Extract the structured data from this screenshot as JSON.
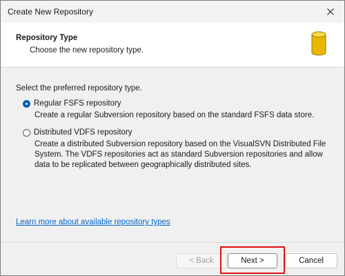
{
  "window": {
    "title": "Create New Repository"
  },
  "header": {
    "title": "Repository Type",
    "subtitle": "Choose the new repository type.",
    "icon": "database-icon"
  },
  "content": {
    "prompt": "Select the preferred repository type.",
    "options": [
      {
        "label": "Regular FSFS repository",
        "selected": true,
        "description": "Create a regular Subversion repository based on the standard FSFS data store."
      },
      {
        "label": "Distributed VDFS repository",
        "selected": false,
        "description": "Create a distributed Subversion repository based on the VisualSVN Distributed File System. The VDFS repositories act as standard Subversion repositories and allow data to be replicated between geographically distributed sites."
      }
    ],
    "learn_more_link": "Learn more about available repository types"
  },
  "footer": {
    "back_label": "< Back",
    "back_enabled": false,
    "next_label": "Next >",
    "cancel_label": "Cancel"
  },
  "colors": {
    "accent": "#005fb8",
    "link": "#0066cc",
    "highlight": "#e01010",
    "icon_gold": "#e8b800"
  }
}
